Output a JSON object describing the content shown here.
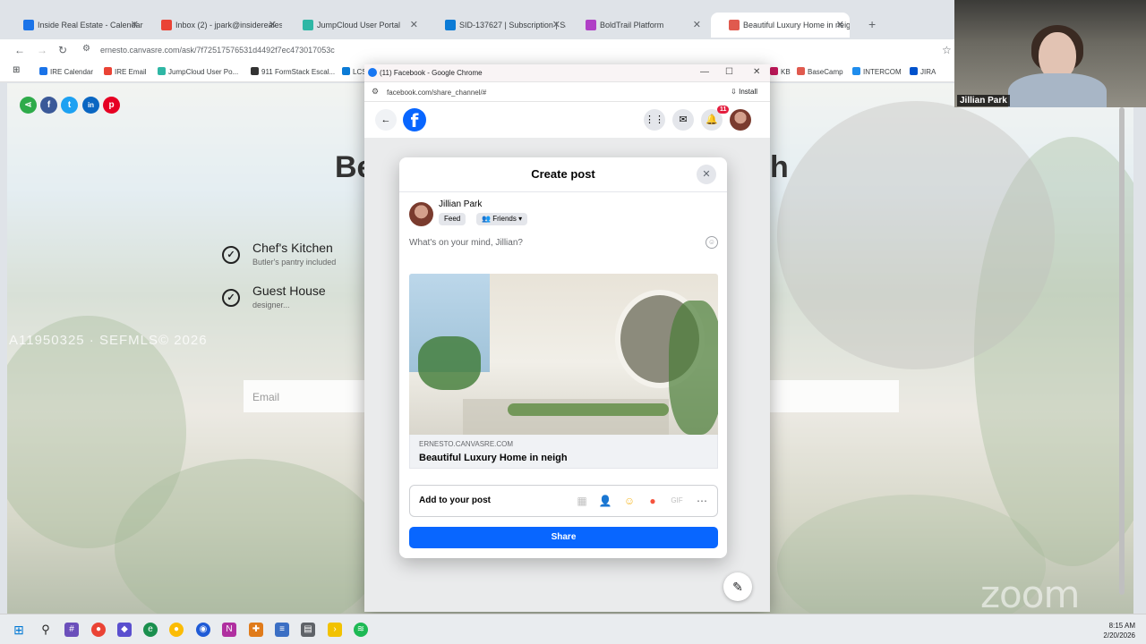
{
  "browser": {
    "tabs": [
      {
        "title": "Inside Real Estate - Calendar - V",
        "color": "#1a73e8",
        "active": false
      },
      {
        "title": "Inbox (2) - jpark@insiderealesta",
        "color": "#ea4335",
        "active": false
      },
      {
        "title": "JumpCloud User Portal",
        "color": "#2fb7a5",
        "active": false
      },
      {
        "title": "SID-137627 | Subscription | Sale",
        "color": "#0b7bd6",
        "active": false
      },
      {
        "title": "BoldTrail Platform",
        "color": "#b040c6",
        "active": false
      },
      {
        "title": "Beautiful Luxury Home in neigh",
        "color": "#e05a4e",
        "active": true
      }
    ],
    "new_tab": "+",
    "url": "ernesto.canvasre.com/ask/7f72517576531d4492f7ec473017053c",
    "bookmarks": [
      {
        "label": "IRE Calendar",
        "color": "#1a73e8"
      },
      {
        "label": "IRE Email",
        "color": "#ea4335"
      },
      {
        "label": "JumpCloud User Po...",
        "color": "#2fb7a5"
      },
      {
        "label": "911 FormStack Escal...",
        "color": "#333333"
      },
      {
        "label": "LCS",
        "color": "#0b7bd6"
      },
      {
        "label": "KB",
        "color": "#c2185b"
      },
      {
        "label": "BaseCamp",
        "color": "#e05a4e"
      },
      {
        "label": "INTERCOM",
        "color": "#1f8ded"
      },
      {
        "label": "JIRA",
        "color": "#0052cc"
      }
    ]
  },
  "listing_page": {
    "title_left": "Be",
    "title_right": "h",
    "features": [
      {
        "title": "Chef's Kitchen",
        "subtitle": "Butler's pantry included"
      },
      {
        "title": "Guest House",
        "subtitle": "designer..."
      }
    ],
    "watermark": "A11950325 · SEFMLS© 2026",
    "email_placeholder": "Email",
    "share_icons": [
      {
        "name": "share-icon",
        "glyph": "⋖",
        "color": "#2eab4a"
      },
      {
        "name": "facebook-icon",
        "glyph": "f",
        "color": "#3b5998"
      },
      {
        "name": "twitter-icon",
        "glyph": "t",
        "color": "#1da1f2"
      },
      {
        "name": "linkedin-icon",
        "glyph": "in",
        "color": "#0a66c2"
      },
      {
        "name": "pinterest-icon",
        "glyph": "p",
        "color": "#e60023"
      }
    ]
  },
  "popup": {
    "window_title": "(11) Facebook - Google Chrome",
    "url": "facebook.com/share_channel/#",
    "install_label": "Install",
    "notification_count": "11"
  },
  "create_post": {
    "title": "Create post",
    "user_name": "Jillian Park",
    "feed_label": "Feed",
    "audience_label": "Friends",
    "placeholder": "What's on your mind, Jillian?",
    "link_domain": "ERNESTO.CANVASRE.COM",
    "link_title": "Beautiful Luxury Home in neigh",
    "add_to_post_label": "Add to your post",
    "share_label": "Share",
    "brand_color": "#0866ff"
  },
  "webcam": {
    "participant_name": "Jillian Park"
  },
  "zoom_watermark": "zoom",
  "taskbar": {
    "time": "8:15 AM",
    "date": "2/20/2026"
  }
}
